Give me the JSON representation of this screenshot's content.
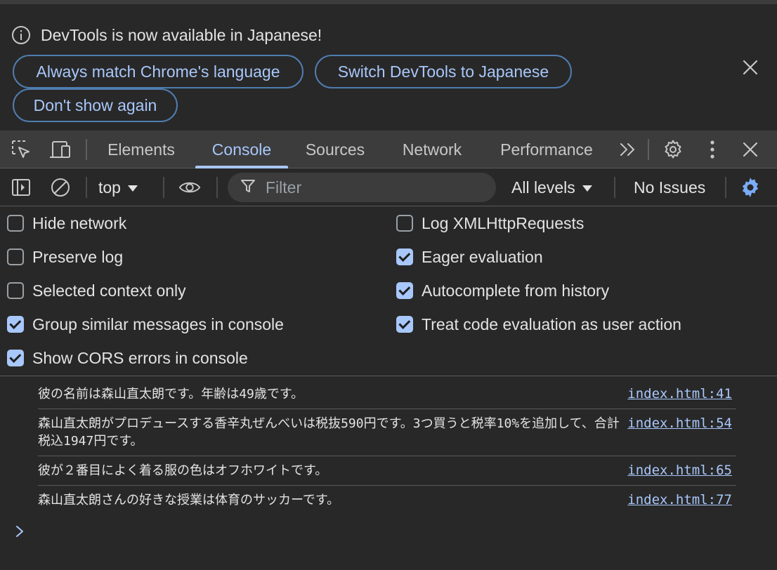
{
  "infobar": {
    "message": "DevTools is now available in Japanese!",
    "buttons": {
      "always_match": "Always match Chrome's language",
      "switch": "Switch DevTools to Japanese",
      "dont_show": "Don't show again"
    },
    "icon": "info-icon",
    "close_icon": "close-icon"
  },
  "toolbar": {
    "icons": [
      "inspect-element-icon",
      "device-toggle-icon",
      "more-tabs-icon",
      "gear-icon",
      "kebab-menu-icon",
      "close-icon"
    ],
    "tabs": [
      {
        "label": "Elements",
        "active": false
      },
      {
        "label": "Console",
        "active": true
      },
      {
        "label": "Sources",
        "active": false
      },
      {
        "label": "Network",
        "active": false
      },
      {
        "label": "Performance",
        "active": false
      }
    ]
  },
  "console_toolbar": {
    "context": "top",
    "filter_placeholder": "Filter",
    "levels": "All levels",
    "issues": "No Issues",
    "icons": [
      "sidebar-toggle-icon",
      "clear-console-icon",
      "eye-icon",
      "filter-icon",
      "settings-gear-icon"
    ]
  },
  "settings": {
    "left": [
      {
        "label": "Hide network",
        "checked": false
      },
      {
        "label": "Preserve log",
        "checked": false
      },
      {
        "label": "Selected context only",
        "checked": false
      },
      {
        "label": "Group similar messages in console",
        "checked": true
      },
      {
        "label": "Show CORS errors in console",
        "checked": true
      }
    ],
    "right": [
      {
        "label": "Log XMLHttpRequests",
        "checked": false
      },
      {
        "label": "Eager evaluation",
        "checked": true
      },
      {
        "label": "Autocomplete from history",
        "checked": true
      },
      {
        "label": "Treat code evaluation as user action",
        "checked": true
      }
    ]
  },
  "messages": [
    {
      "text": "彼の名前は森山直太朗です。年齢は49歳です。",
      "source": "index.html:41"
    },
    {
      "text": "森山直太朗がプロデュースする香辛丸ぜんべいは税抜590円です。3つ買うと税率10%を追加して、合計税込1947円です。",
      "source": "index.html:54"
    },
    {
      "text": "彼が２番目によく着る服の色はオフホワイトです。",
      "source": "index.html:65"
    },
    {
      "text": "森山直太朗さんの好きな授業は体育のサッカーです。",
      "source": "index.html:77"
    }
  ],
  "colors": {
    "background": "#282828",
    "toolbar": "#3c3c3c",
    "accent": "#a8c7fa",
    "text": "#e3e3e3"
  }
}
